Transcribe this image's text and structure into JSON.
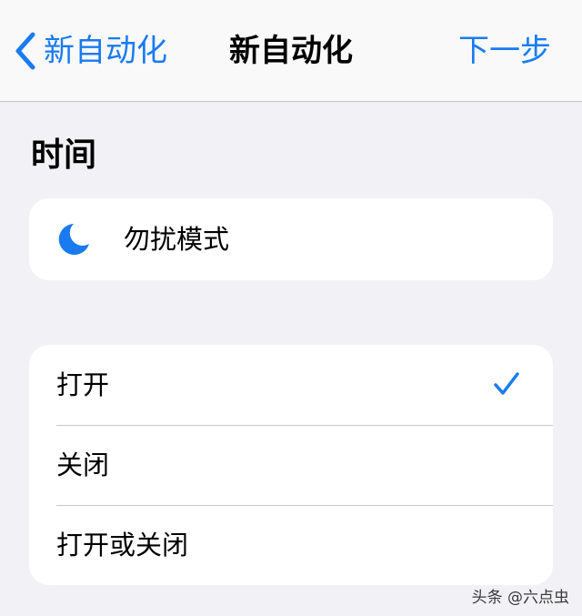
{
  "navbar": {
    "back_label": "新自动化",
    "title": "新自动化",
    "next_label": "下一步"
  },
  "section": {
    "title": "时间"
  },
  "trigger": {
    "icon": "moon-icon",
    "label": "勿扰模式"
  },
  "options": [
    {
      "label": "打开",
      "selected": true
    },
    {
      "label": "关闭",
      "selected": false
    },
    {
      "label": "打开或关闭",
      "selected": false
    }
  ],
  "colors": {
    "accent": "#1a7bf0",
    "background": "#f2f2f6",
    "card": "#ffffff"
  },
  "watermark": "头条 @六点虫"
}
